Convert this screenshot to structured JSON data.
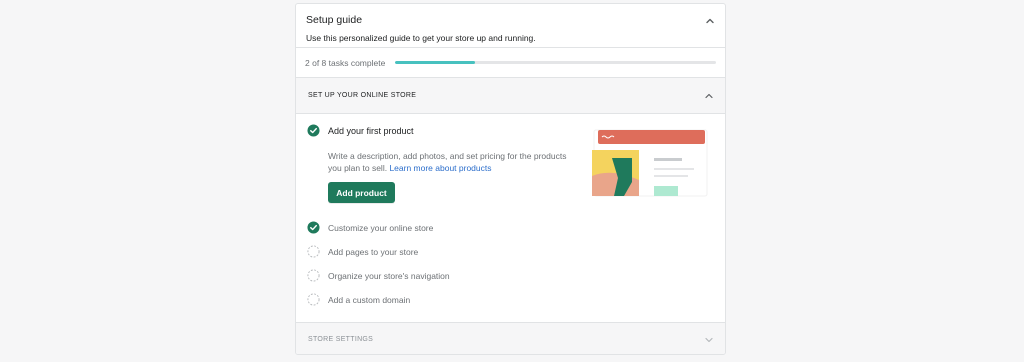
{
  "setup": {
    "title": "Setup guide",
    "subtitle": "Use this personalized guide to get your store up and running.",
    "progress_text": "2 of 8 tasks complete",
    "progress_fraction": 0.25
  },
  "section_online_store": {
    "label": "SET UP YOUR ONLINE STORE",
    "tasks": [
      {
        "label": "Add your first product",
        "completed": true,
        "description": "Write a description, add photos, and set pricing for the products you plan to sell.",
        "link": "Learn more about products",
        "button": "Add product"
      },
      {
        "label": "Customize your online store",
        "completed": true
      },
      {
        "label": "Add pages to your store",
        "completed": false
      },
      {
        "label": "Organize your store's navigation",
        "completed": false
      },
      {
        "label": "Add a custom domain",
        "completed": false
      }
    ]
  },
  "section_store_settings": {
    "label": "STORE SETTINGS"
  },
  "colors": {
    "accent": "#1f7a5c",
    "progress": "#47c1bf",
    "link": "#2c6ecb"
  },
  "icons": {
    "check": "check-circle-icon",
    "todo": "dashed-circle-icon",
    "collapse": "chevron-up-icon",
    "expand": "chevron-down-icon"
  }
}
